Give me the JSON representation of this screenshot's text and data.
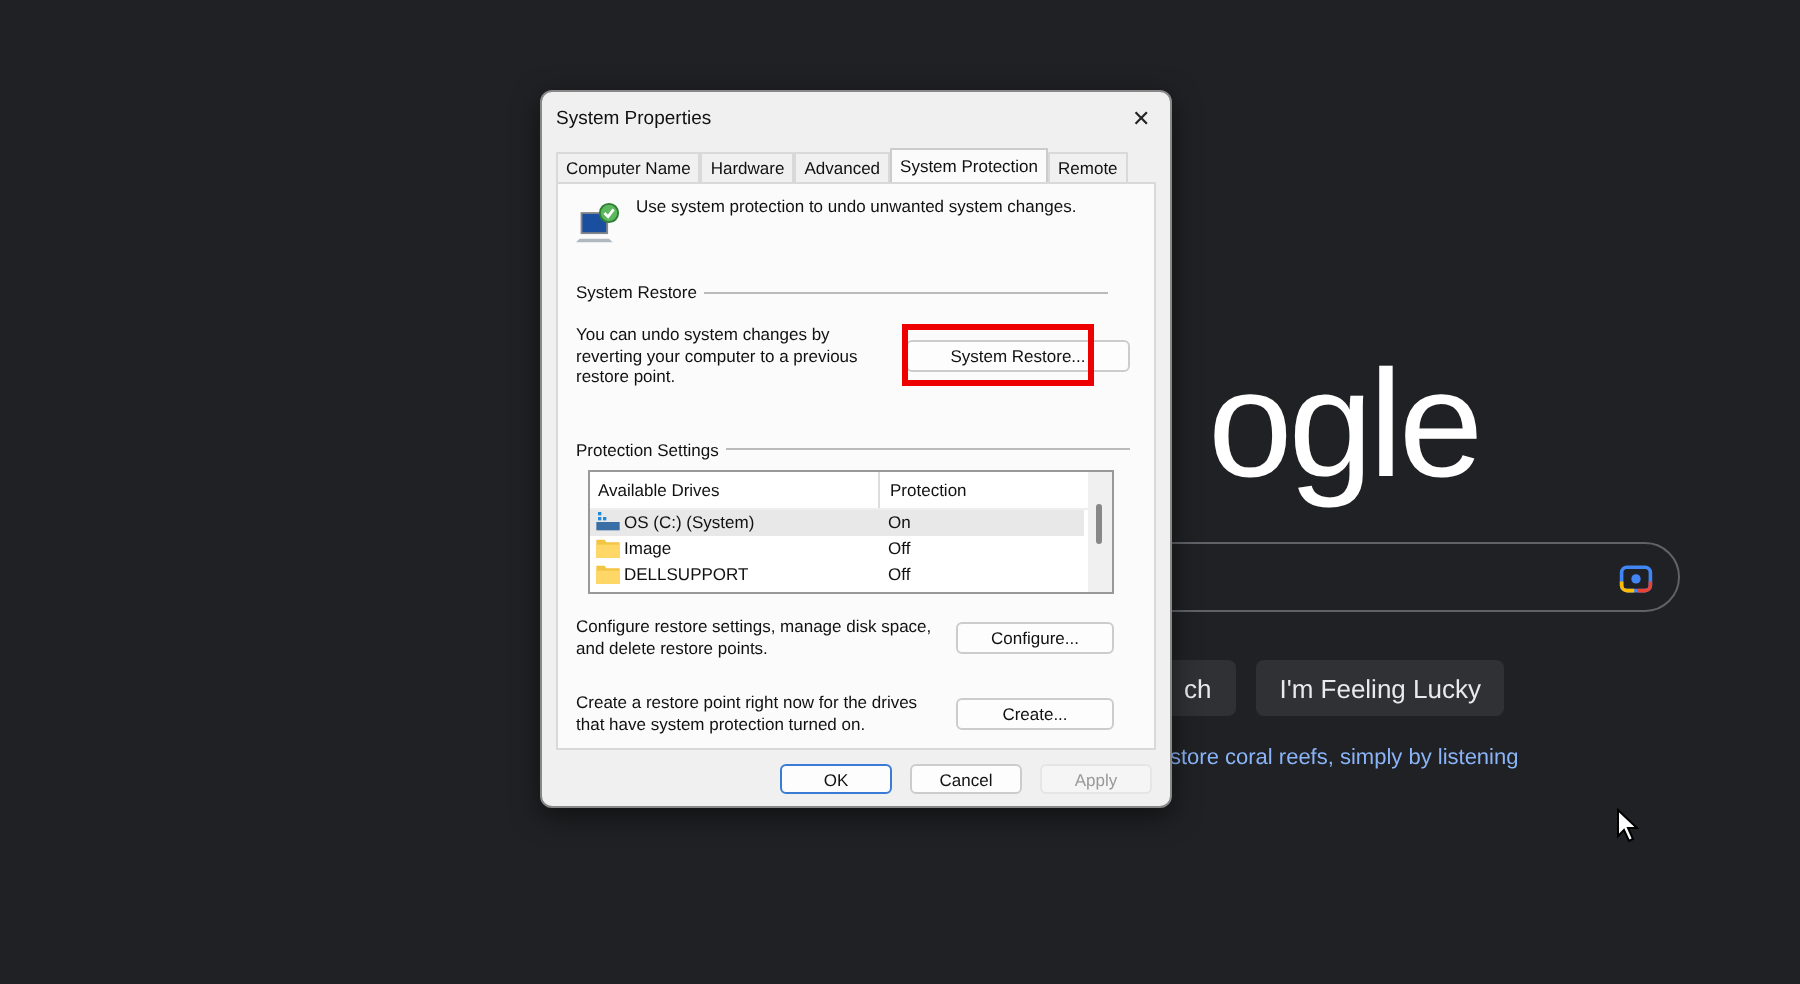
{
  "background": {
    "logo": "ogle",
    "search_buttons": [
      "ch",
      "I'm Feeling Lucky"
    ],
    "promo_link": "store coral reefs, simply by listening"
  },
  "window": {
    "title": "System Properties",
    "close": "✕"
  },
  "tabs": [
    {
      "label": "Computer Name",
      "selected": false
    },
    {
      "label": "Hardware",
      "selected": false
    },
    {
      "label": "Advanced",
      "selected": false
    },
    {
      "label": "System Protection",
      "selected": true
    },
    {
      "label": "Remote",
      "selected": false
    }
  ],
  "intro": "Use system protection to undo unwanted system changes.",
  "system_restore": {
    "heading": "System Restore",
    "text": "You can undo system changes by reverting your computer to a previous restore point.",
    "button": "System Restore...",
    "highlighted": true
  },
  "protection_settings": {
    "heading": "Protection Settings",
    "columns": [
      "Available Drives",
      "Protection"
    ],
    "rows": [
      {
        "drive": "OS (C:) (System)",
        "protection": "On",
        "kind": "system",
        "selected": true
      },
      {
        "drive": "Image",
        "protection": "Off",
        "kind": "folder",
        "selected": false
      },
      {
        "drive": "DELLSUPPORT",
        "protection": "Off",
        "kind": "folder",
        "selected": false
      }
    ],
    "configure_text": "Configure restore settings, manage disk space, and delete restore points.",
    "configure_button": "Configure...",
    "create_text": "Create a restore point right now for the drives that have system protection turned on.",
    "create_button": "Create..."
  },
  "buttons": [
    {
      "label": "OK",
      "default": true,
      "disabled": false
    },
    {
      "label": "Cancel",
      "default": false,
      "disabled": false
    },
    {
      "label": "Apply",
      "default": false,
      "disabled": true
    }
  ]
}
